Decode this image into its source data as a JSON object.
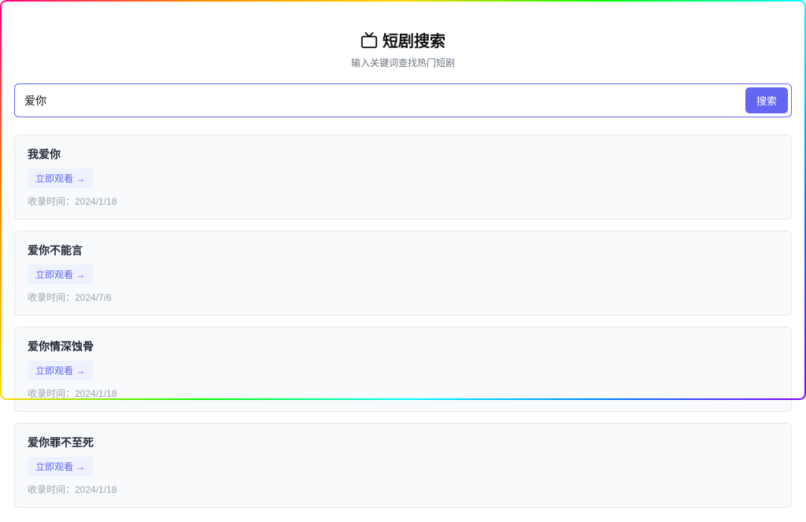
{
  "header": {
    "title": "短剧搜索",
    "subtitle": "输入关键词查找热门短剧"
  },
  "search": {
    "value": "爱你",
    "button_label": "搜索"
  },
  "watch_label": "立即观看 →",
  "date_prefix": "收录时间：",
  "results": [
    {
      "title": "我爱你",
      "date": "2024/1/18"
    },
    {
      "title": "爱你不能言",
      "date": "2024/7/6"
    },
    {
      "title": "爱你情深蚀骨",
      "date": "2024/1/18"
    },
    {
      "title": "爱你罪不至死",
      "date": "2024/1/18"
    }
  ]
}
